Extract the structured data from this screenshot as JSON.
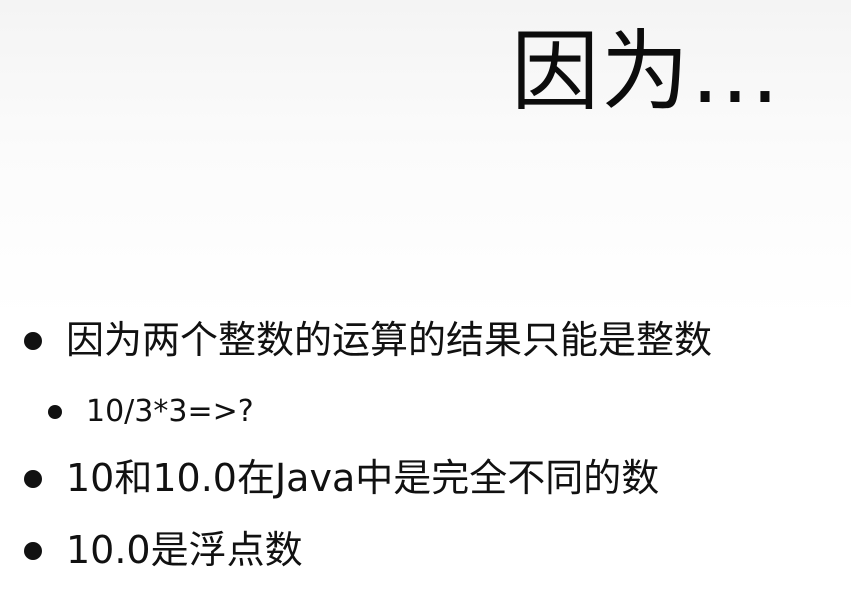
{
  "slide": {
    "title": "因为...",
    "bullets": [
      {
        "text": "因为两个整数的运算的结果只能是整数",
        "level": 1
      },
      {
        "text": "10/3*3=>?",
        "level": 2
      },
      {
        "text": "10和10.0在Java中是完全不同的数",
        "level": 1
      },
      {
        "text": "10.0是浮点数",
        "level": 1
      }
    ]
  }
}
